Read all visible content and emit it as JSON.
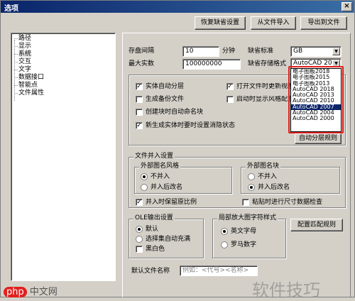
{
  "window": {
    "title": "选项",
    "close_label": "×"
  },
  "toolbar": {
    "restore_label": "恢复缺省设置",
    "import_label": "从文件导入",
    "export_label": "导出到文件"
  },
  "tree": {
    "items": [
      "路径",
      "显示",
      "系统",
      "交互",
      "文字",
      "数据接口",
      "智能点",
      "文件属性"
    ]
  },
  "save": {
    "interval_label": "存盘间隔",
    "interval_value": "10",
    "interval_unit": "分钟",
    "max_undo_label": "最大实数",
    "max_undo_value": "100000000",
    "standard_label": "缺省标准",
    "standard_value": "GB",
    "format_label": "缺省存储格式",
    "format_value": "AutoCAD 2007"
  },
  "format_options": [
    "电子图板2018",
    "电子图板2015",
    "电子图板2013",
    "AutoCAD 2018",
    "AutoCAD 2013",
    "AutoCAD 2010",
    "AutoCAD 2007",
    "AutoCAD 2004",
    "AutoCAD 2000"
  ],
  "format_selected_index": 6,
  "options": {
    "entity_auto_layer": "实体自动分层",
    "open_file_update": "打开文件时更新视图",
    "backup_file": "生成备份文件",
    "auto_show_style": "启动时显示风格配置",
    "block_auto_name": "创建块时自动命名块",
    "new_entity_no_undo": "新生成实体时要时设置消隐状态",
    "auto_layer_rules_button": "自动分层规则"
  },
  "merge": {
    "title": "文件并入设置",
    "ext_style_group": "外部图名风格",
    "ext_style_opt1": "不并入",
    "ext_style_opt2": "并入后改名",
    "ext_block_group": "外部图名块",
    "ext_block_opt1": "不并入",
    "ext_block_opt2": "并入后改名",
    "keep_scale": "并入时保留原比例",
    "paste_dim_check": "粘贴时进行尺寸数据检查"
  },
  "ole": {
    "title": "OLE输出设置",
    "opt1": "默认",
    "opt2": "选择集自动充满",
    "opt3": "黑白色"
  },
  "local_zoom": {
    "title": "局部放大图字符样式",
    "opt1": "英文字母",
    "opt2": "罗马数字",
    "config_button": "配置匹配规则"
  },
  "filename": {
    "label": "默认文件名称",
    "placeholder": "例如：<代号><名称>"
  },
  "watermarks": {
    "right": "软件技巧",
    "left_logo": "php",
    "left_text": "中文网"
  }
}
